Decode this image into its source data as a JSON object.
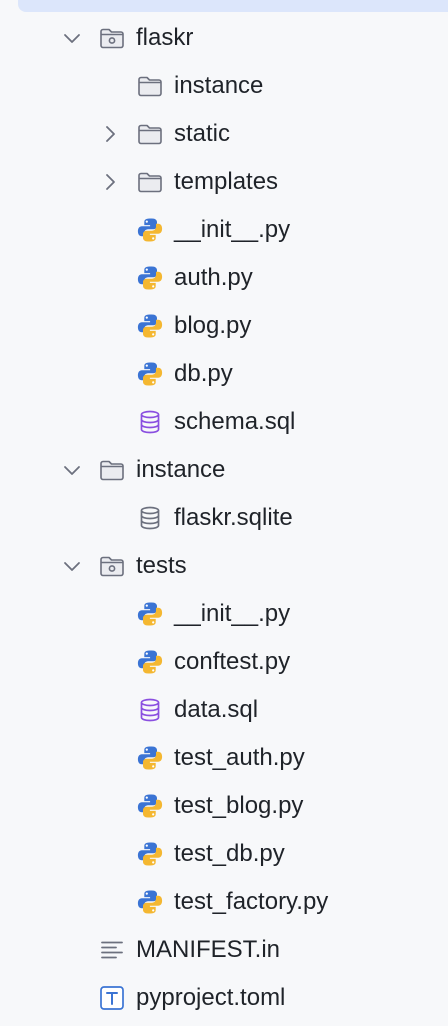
{
  "tree": {
    "flaskr": {
      "label": "flaskr",
      "children": {
        "instance": "instance",
        "static": "static",
        "templates": "templates",
        "init": "__init__.py",
        "auth": "auth.py",
        "blog": "blog.py",
        "db": "db.py",
        "schema": "schema.sql"
      }
    },
    "instance": {
      "label": "instance",
      "children": {
        "sqlite": "flaskr.sqlite"
      }
    },
    "tests": {
      "label": "tests",
      "children": {
        "init": "__init__.py",
        "conftest": "conftest.py",
        "data": "data.sql",
        "test_auth": "test_auth.py",
        "test_blog": "test_blog.py",
        "test_db": "test_db.py",
        "test_factory": "test_factory.py"
      }
    },
    "manifest": "MANIFEST.in",
    "pyproject": "pyproject.toml"
  },
  "icons": {
    "folder": "folder-icon",
    "package_folder": "package-folder-icon",
    "python": "python-file-icon",
    "sql": "sql-file-icon",
    "sqlite": "database-file-icon",
    "text": "text-file-icon",
    "toml": "toml-file-icon",
    "chevron_down": "chevron-down-icon",
    "chevron_right": "chevron-right-icon"
  },
  "colors": {
    "background": "#f7f8fa",
    "selection": "#dce6fb",
    "python_blue": "#3b74d4",
    "python_yellow": "#f4b731",
    "sql_purple": "#8a4fe0",
    "gray_icon": "#6c707e",
    "toml_blue": "#3b74d4"
  }
}
